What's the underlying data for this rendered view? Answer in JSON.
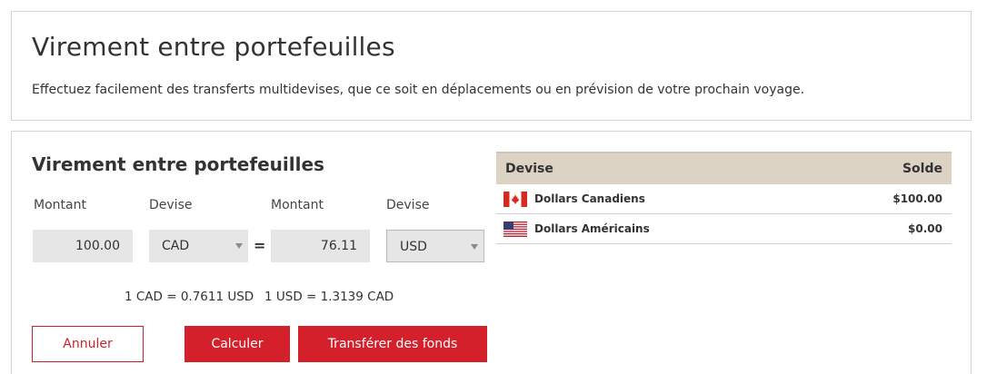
{
  "header": {
    "title": "Virement entre portefeuilles",
    "subtitle": "Effectuez facilement des transferts multidevises, que ce soit en déplacements ou en prévision de votre prochain voyage."
  },
  "form": {
    "title": "Virement entre portefeuilles",
    "from_amount_label": "Montant",
    "from_currency_label": "Devise",
    "to_amount_label": "Montant",
    "to_currency_label": "Devise",
    "from_amount": "100.00",
    "from_currency": "CAD",
    "equals": "=",
    "to_amount": "76.11",
    "to_currency": "USD",
    "rate_cad_usd": "1 CAD = 0.7611 USD",
    "rate_usd_cad": "1 USD = 1.3139 CAD",
    "cancel_label": "Annuler",
    "calculate_label": "Calculer",
    "transfer_label": "Transférer des fonds"
  },
  "balances": {
    "header_currency": "Devise",
    "header_balance": "Solde",
    "rows": [
      {
        "flag_icon": "canada-flag-icon",
        "currency": "Dollars Canadiens",
        "balance": "$100.00"
      },
      {
        "flag_icon": "usa-flag-icon",
        "currency": "Dollars Américains",
        "balance": "$0.00"
      }
    ]
  },
  "colors": {
    "accent_red": "#d4202a",
    "table_header_bg": "#ddd3c5",
    "field_bg": "#e6e6e6"
  }
}
